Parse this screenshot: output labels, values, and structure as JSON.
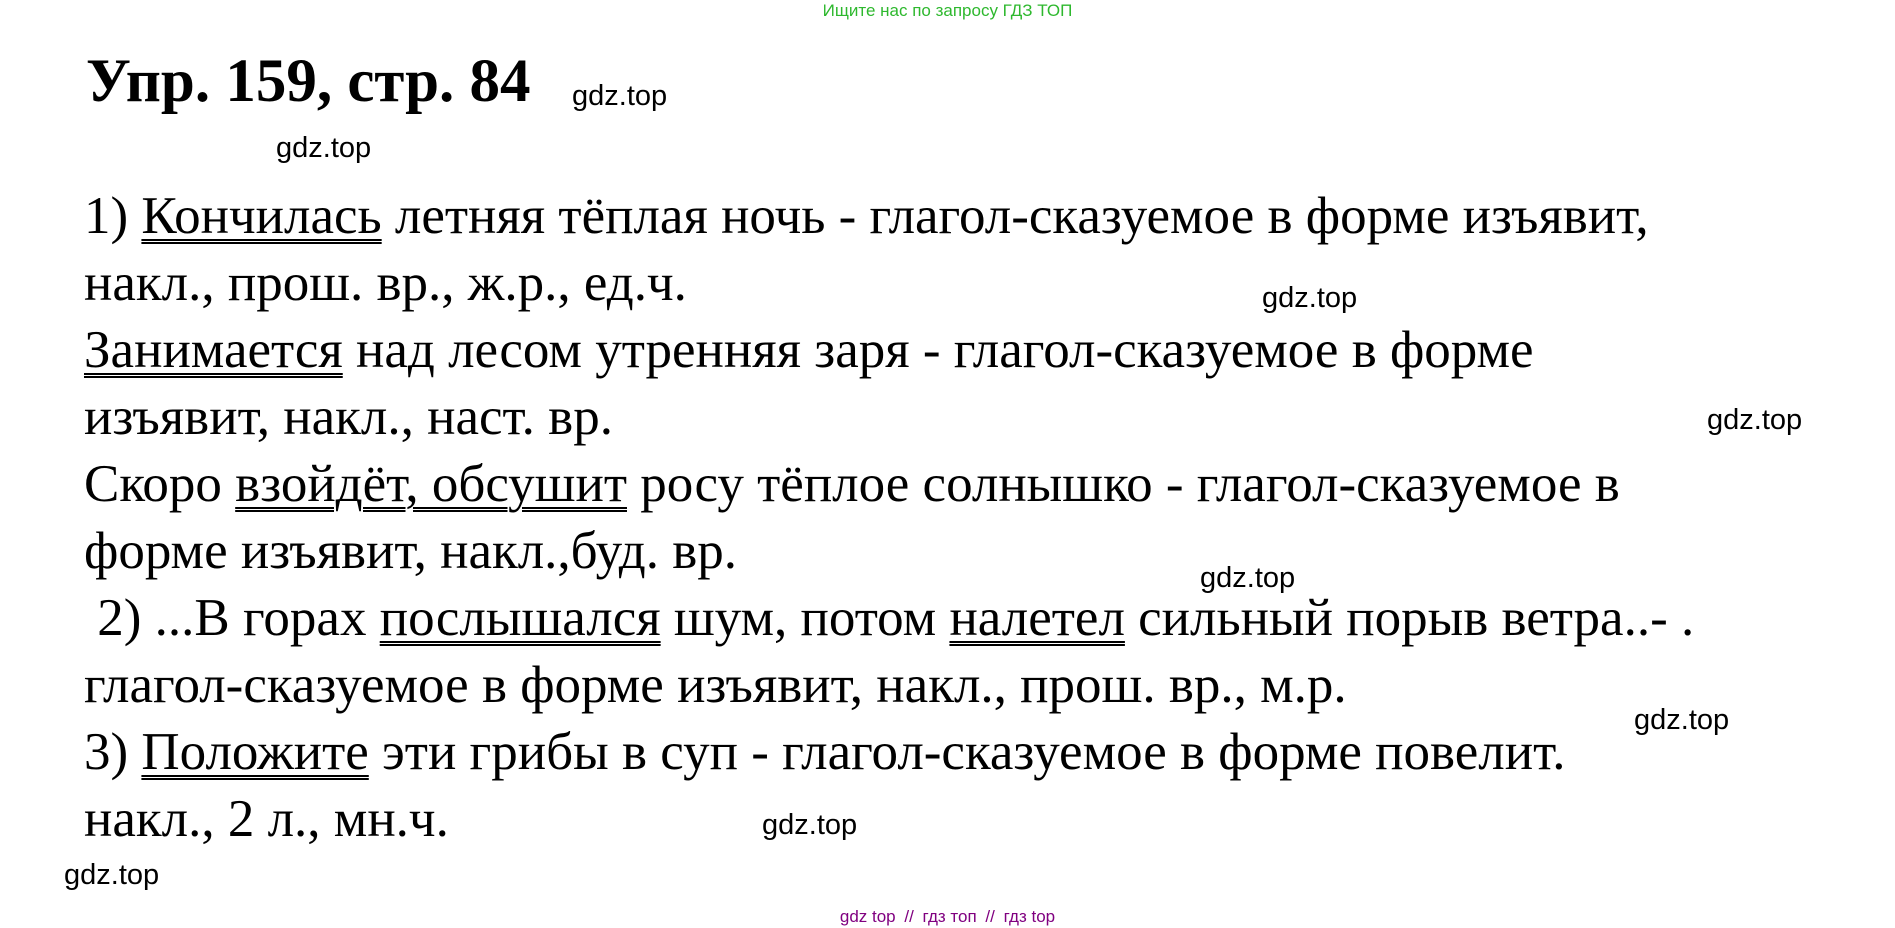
{
  "banner": "Ищите нас по запросу ГДЗ ТОП",
  "title": "Упр. 159, стр. 84",
  "watermark": "gdz.top",
  "lines": [
    [
      "1) ",
      {
        "u": "Кончилась"
      },
      " летняя тёплая ночь - глагол-сказуемое в форме изъявит,"
    ],
    [
      "накл., прош. вр., ж.р., ед.ч."
    ],
    [
      {
        "u": "Занимается"
      },
      " над лесом утренняя заря - глагол-сказуемое в форме"
    ],
    [
      "изъявит, накл., наст. вр."
    ],
    [
      "Скоро ",
      {
        "u": "взойдёт, обсушит"
      },
      " росу тёплое солнышко - глагол-сказуемое в"
    ],
    [
      "форме изъявит, накл.,буд. вр."
    ],
    [
      " 2) ...В горах ",
      {
        "u": "послышался"
      },
      " шум, потом ",
      {
        "u": "налетел"
      },
      " сильный порыв ветра..- ."
    ],
    [
      "глагол-сказуемое в форме изъявит, накл., прош. вр., м.р."
    ],
    [
      "3) ",
      {
        "u": "Положите"
      },
      " эти грибы в суп - глагол-сказуемое в форме повелит."
    ],
    [
      "накл., 2 л., мн.ч."
    ]
  ],
  "footer": {
    "links": [
      "gdz top",
      "гдз топ",
      "гдз top"
    ],
    "separator": "//"
  }
}
